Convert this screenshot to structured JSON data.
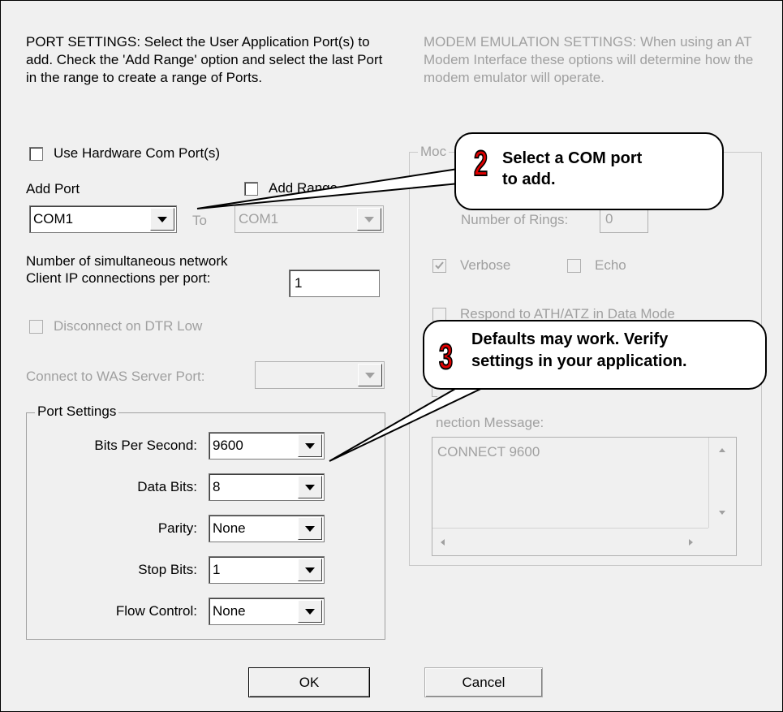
{
  "port_settings_header": "PORT SETTINGS: Select the User Application Port(s) to add. Check the 'Add Range' option and select the last Port in the range to create a range of Ports.",
  "modem_header": "MODEM EMULATION SETTINGS: When using an AT Modem Interface these options will determine how the modem emulator will operate.",
  "use_hardware_label": "Use Hardware Com Port(s)",
  "add_port_label": "Add Port",
  "add_range_label": "Add Range",
  "add_port_value": "COM1",
  "to_label": "To",
  "to_port_value": "COM1",
  "connections_label_1": "Number of simultaneous network",
  "connections_label_2": "Client IP connections per port:",
  "connections_value": "1",
  "disconnect_label": "Disconnect on DTR Low",
  "was_label": "Connect to WAS Server Port:",
  "was_value": "",
  "port_group_title": "Port Settings",
  "port_fields": {
    "bps_label": "Bits Per Second:",
    "bps_value": "9600",
    "data_label": "Data Bits:",
    "data_value": "8",
    "parity_label": "Parity:",
    "parity_value": "None",
    "stop_label": "Stop Bits:",
    "stop_value": "1",
    "flow_label": "Flow Control:",
    "flow_value": "None"
  },
  "modem_group_title": "Moc",
  "rings_label": "Number of Rings:",
  "rings_value": "0",
  "verbose_label": "Verbose",
  "echo_label": "Echo",
  "respond_label": "Respond to ATH/ATZ in Data Mode",
  "connection_message_label": "nection Message:",
  "connection_message_value": "CONNECT 9600",
  "ok_label": "OK",
  "cancel_label": "Cancel",
  "callout2_number": "2",
  "callout2_text_1": "Select a COM port",
  "callout2_text_2": "to add.",
  "callout3_number": "3",
  "callout3_text_1": "Defaults may work. Verify",
  "callout3_text_2": "settings in your application.",
  "colors": {
    "background": "#f0f0f0",
    "disabled_text": "#a0a0a0",
    "callout_number": "#e00000"
  }
}
